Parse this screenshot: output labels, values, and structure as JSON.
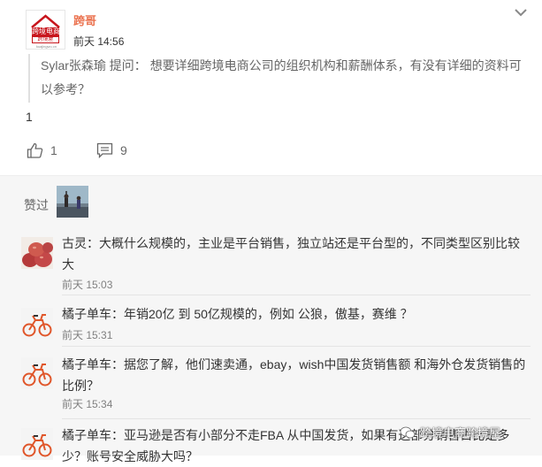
{
  "post": {
    "author": "跨哥",
    "time": "前天 14:56",
    "quote": {
      "name": "Sylar张森瑜",
      "prefix": " 提问： ",
      "text": "想要详细跨境电商公司的组织机构和薪酬体系，有没有详细的资料可以参考？"
    },
    "content": "1",
    "like_count": "1",
    "comment_count": "9",
    "avatar": {
      "line1": "跨境电商",
      "line2": "跨境屋",
      "domain": "kuajingwu.cn"
    }
  },
  "likes": {
    "label": "赞过"
  },
  "comments": [
    {
      "user": "古灵",
      "sep": "：",
      "text": "大概什么规模的，主业是平台销售，独立站还是平台型的，不同类型区别比较大",
      "time": "前天 15:03"
    },
    {
      "user": "橘子单车",
      "sep": "：",
      "text": "年销20亿 到 50亿规模的，例如 公狼，傲基，赛维 ？",
      "time": "前天 15:31"
    },
    {
      "user": "橘子单车",
      "sep": "：",
      "text": "据您了解，他们速卖通，ebay，wish中国发货销售额 和海外仓发货销售的 比例？",
      "time": "前天 15:34"
    },
    {
      "user": "橘子单车",
      "sep": "：",
      "text": "亚马逊是否有小部分不走FBA 从中国发货，如果有这部分销售占比是多少？账号安全威胁大吗？",
      "time": ""
    }
  ],
  "watermark": {
    "text": "跨境电商跨境屋"
  },
  "colors": {
    "author": "#eb7350",
    "brand_red": "#c8161d",
    "page_bg": "#f6f6f6"
  },
  "icons": {
    "menu": "chevron-down-icon",
    "like": "thumbs-up-icon",
    "comment": "comment-icon"
  }
}
